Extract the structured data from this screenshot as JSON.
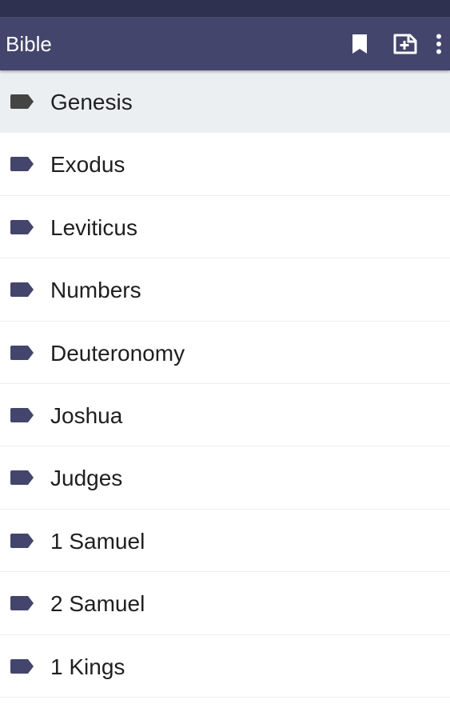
{
  "app_bar": {
    "title": "Bible",
    "actions": [
      {
        "icon": "bookmark-icon"
      },
      {
        "icon": "add-note-icon"
      },
      {
        "icon": "more-vert-icon"
      }
    ]
  },
  "colors": {
    "status_bar": "#2f3150",
    "app_bar": "#43456c",
    "tag": "#43456c",
    "tag_active": "#444444",
    "active_row": "#eceff2"
  },
  "books": [
    {
      "label": "Genesis",
      "selected": true
    },
    {
      "label": "Exodus",
      "selected": false
    },
    {
      "label": "Leviticus",
      "selected": false
    },
    {
      "label": "Numbers",
      "selected": false
    },
    {
      "label": "Deuteronomy",
      "selected": false
    },
    {
      "label": "Joshua",
      "selected": false
    },
    {
      "label": "Judges",
      "selected": false
    },
    {
      "label": "1 Samuel",
      "selected": false
    },
    {
      "label": "2 Samuel",
      "selected": false
    },
    {
      "label": "1 Kings",
      "selected": false
    }
  ]
}
